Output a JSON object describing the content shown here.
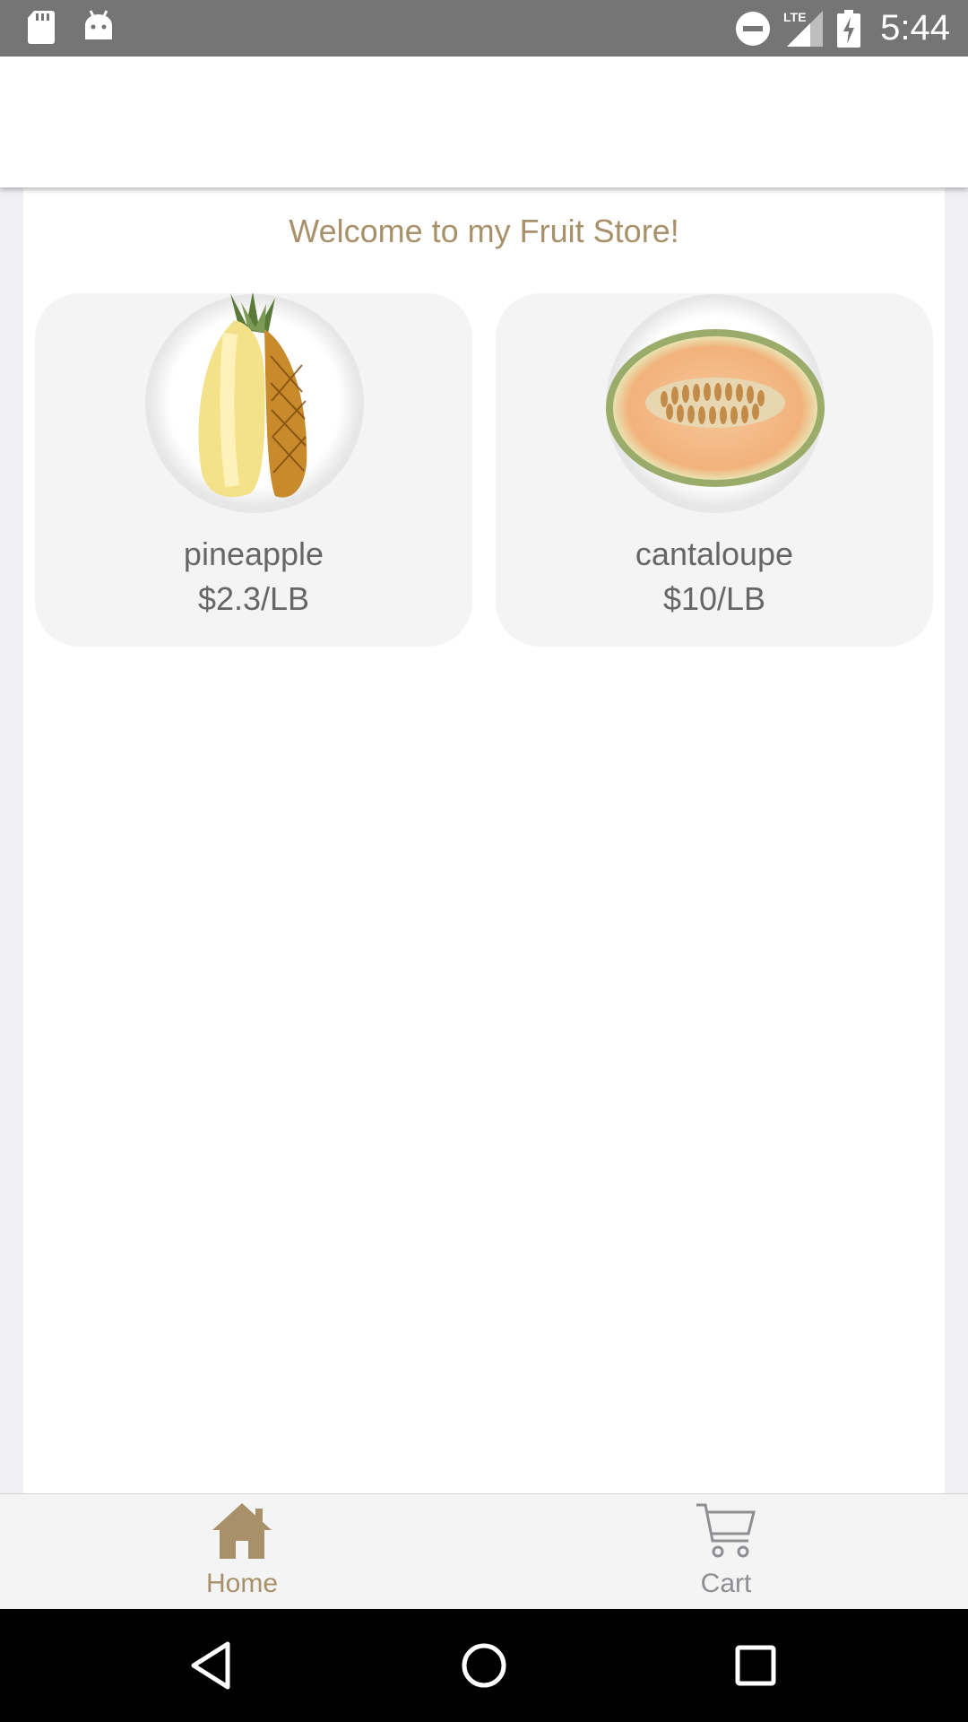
{
  "status_bar": {
    "time": "5:44",
    "network": "LTE",
    "icons": [
      "sd-card-icon",
      "android-icon",
      "do-not-disturb-icon",
      "signal-icon",
      "battery-charging-icon"
    ]
  },
  "main": {
    "welcome": "Welcome to my Fruit Store!",
    "products": [
      {
        "name": "pineapple",
        "price": "$2.3/LB",
        "image": "pineapple-image"
      },
      {
        "name": "cantaloupe",
        "price": "$10/LB",
        "image": "cantaloupe-image"
      }
    ]
  },
  "tabs": [
    {
      "label": "Home",
      "icon": "home-icon",
      "active": true
    },
    {
      "label": "Cart",
      "icon": "cart-icon",
      "active": false
    }
  ],
  "nav_bar": {
    "icons": [
      "back-icon",
      "home-circle-icon",
      "recents-icon"
    ]
  },
  "colors": {
    "accent": "#a8916a",
    "inactive": "#8e8e93",
    "status_bar": "#757575",
    "card_bg": "#f4f4f4"
  }
}
